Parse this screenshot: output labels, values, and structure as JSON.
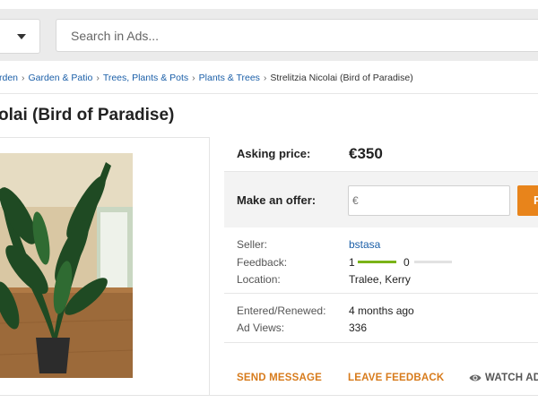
{
  "search": {
    "placeholder": "Search in Ads..."
  },
  "breadcrumb": {
    "items": [
      "rden",
      "Garden & Patio",
      "Trees, Plants & Pots",
      "Plants & Trees"
    ],
    "current": "Strelitzia Nicolai (Bird of Paradise)"
  },
  "ad": {
    "title": "olai (Bird of Paradise)",
    "asking_label": "Asking price:",
    "asking_price": "€350",
    "offer_label": "Make an offer:",
    "offer_placeholder": "€",
    "offer_button": "P",
    "seller_label": "Seller:",
    "seller_name": "bstasa",
    "feedback_label": "Feedback:",
    "feedback_positive": "1",
    "feedback_negative": "0",
    "feedback_positive_share": 1.0,
    "location_label": "Location:",
    "location": "Tralee, Kerry",
    "entered_label": "Entered/Renewed:",
    "entered": "4 months ago",
    "views_label": "Ad Views:",
    "views": "336"
  },
  "actions": {
    "send_message": "SEND MESSAGE",
    "leave_feedback": "LEAVE FEEDBACK",
    "watch_ad": "WATCH AD"
  },
  "colors": {
    "accent": "#e8841b",
    "link": "#1b5fa8",
    "feedback_bar": "#7ab317"
  }
}
